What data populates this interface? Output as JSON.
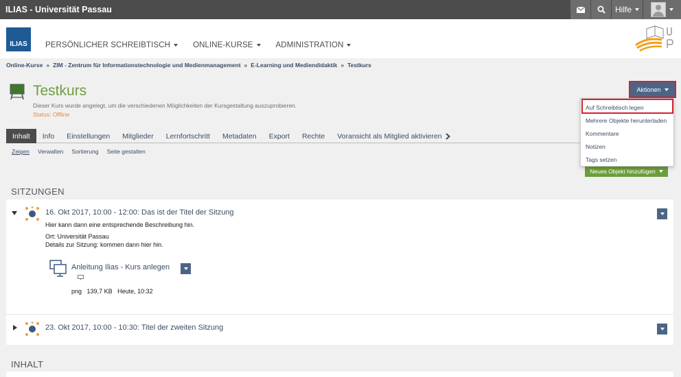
{
  "topbar": {
    "brand": "ILIAS - Universität Passau",
    "help_label": "Hilfe"
  },
  "header": {
    "logo_text": "ILIAS",
    "nav": [
      "PERSÖNLICHER SCHREIBTISCH",
      "ONLINE-KURSE",
      "ADMINISTRATION"
    ]
  },
  "breadcrumb": [
    "Online-Kurse",
    "ZIM - Zentrum für Informationstechnologie und Medienmanagement",
    "E-Learning und Mediendidaktik",
    "Testkurs"
  ],
  "course": {
    "title": "Testkurs",
    "description": "Dieser Kurs wurde angelegt, um die verschiedenen Möglichkeiten der Kursgestaltung auszuprobieren.",
    "status": "Status: Offline"
  },
  "actions": {
    "label": "Aktionen",
    "items": [
      "Auf Schreibtisch legen",
      "Mehrere Objekte herunterladen",
      "Kommentare",
      "Notizen",
      "Tags setzen"
    ]
  },
  "tabs": [
    "Inhalt",
    "Info",
    "Einstellungen",
    "Mitglieder",
    "Lernfortschritt",
    "Metadaten",
    "Export",
    "Rechte",
    "Voransicht als Mitglied aktivieren"
  ],
  "subtabs": [
    "Zeigen",
    "Verwalten",
    "Sortierung",
    "Seite gestalten"
  ],
  "new_object_label": "Neues Objekt hinzufügen",
  "sections": {
    "sessions": "SITZUNGEN",
    "content": "INHALT"
  },
  "sessions": [
    {
      "title": "16. Okt 2017, 10:00 - 12:00: Das ist der Titel der Sitzung",
      "description": "Hier kann dann eine entsprechende Beschreibung hin.",
      "location": "Ort: Universität Passau",
      "details": "Details zur Sitzung: kommen dann hier hin.",
      "file": {
        "title": "Anleitung Ilias - Kurs anlegen",
        "format": "png",
        "size": "139,7 KB",
        "date": "Heute, 10:32"
      }
    },
    {
      "title": "23. Okt 2017, 10:00 - 10:30: Titel der zweiten Sitzung"
    }
  ],
  "colors": {
    "topbar": "#4c4c4c",
    "accent_blue": "#4c6586",
    "accent_green": "#6c9e3a",
    "highlight_red": "#d8202d",
    "status_orange": "#e08c3a"
  }
}
